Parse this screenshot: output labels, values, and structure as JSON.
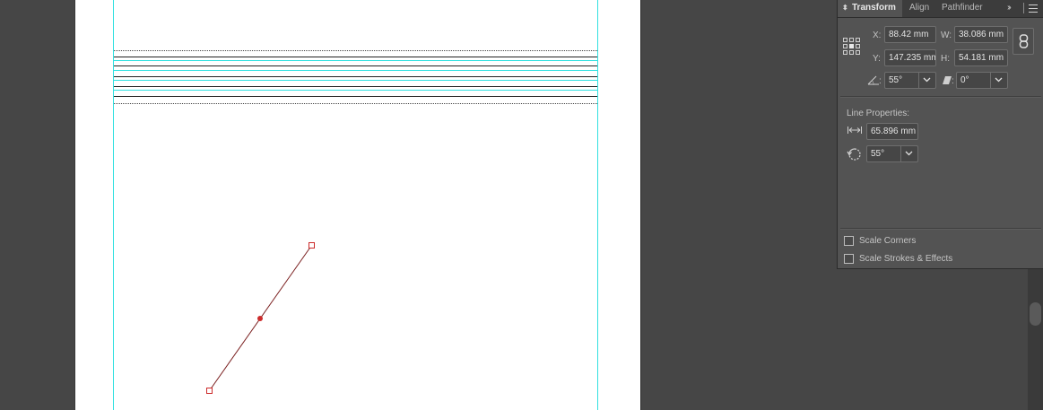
{
  "panel": {
    "tabs": [
      {
        "label": "Transform",
        "active": true
      },
      {
        "label": "Align",
        "active": false
      },
      {
        "label": "Pathfinder",
        "active": false
      }
    ],
    "more_glyph": "››",
    "fields": {
      "x": {
        "label": "X:",
        "value": "88.42 mm"
      },
      "y": {
        "label": "Y:",
        "value": "147.235 mm"
      },
      "w": {
        "label": "W:",
        "value": "38.086 mm"
      },
      "h": {
        "label": "H:",
        "value": "54.181 mm"
      },
      "rotate": {
        "label": ":",
        "value": "55°"
      },
      "shear": {
        "label": ":",
        "value": "0°"
      }
    },
    "line_properties": {
      "title": "Line Properties:",
      "length": "65.896 mm",
      "angle": "55°"
    },
    "options": [
      {
        "label": "Scale Corners",
        "checked": false
      },
      {
        "label": "Scale Strokes & Effects",
        "checked": false
      }
    ]
  },
  "colors": {
    "pasteboard": "#464646",
    "panel_bg": "#535353",
    "guide": "#32e0e0",
    "selection": "#cc2b2b"
  },
  "icons": [
    "collapse-arrows-icon",
    "panel-menu-icon",
    "reference-point-icon",
    "constrain-proportions-icon",
    "rotate-angle-icon",
    "shear-angle-icon",
    "line-length-icon",
    "line-rotate-icon",
    "chevron-down-icon"
  ]
}
